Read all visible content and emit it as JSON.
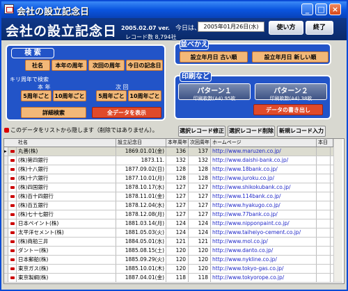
{
  "window": {
    "title": "会社の設立記念日"
  },
  "header": {
    "title": "会社の設立記念日",
    "version": "2005.02.07 ver.",
    "record_count": "レコード数 8,794社",
    "today_label": "今日は、",
    "today_value": "2005年01月26日(水)",
    "howto_label": "使い方",
    "exit_label": "終了"
  },
  "search": {
    "heading": "検 索",
    "buttons": [
      "社名",
      "本年の周年",
      "次回の周年",
      "今日の記念日"
    ],
    "kiri_label": "キリ周年で検索",
    "this_year_label": "本 年",
    "next_label": "次 回",
    "kiri_buttons": [
      "5周年ごと",
      "10周年ごと",
      "5周年ごと",
      "10周年ごと"
    ],
    "detail_label": "詳細検索",
    "showall_label": "全データを表示"
  },
  "sort": {
    "heading": "並べかえ",
    "asc_label": "設立年月日 古い順",
    "desc_label": "設立年月日 新しい順"
  },
  "print": {
    "heading": "印刷など",
    "p1_title": "パターン１",
    "p1_sub": "印刷枚数(A4)   95枚",
    "p2_title": "パターン２",
    "p2_sub": "印刷枚数(A4)   38枚",
    "export_label": "データの書き出し"
  },
  "notice": "このデータをリストから隠します（削除ではありません）。",
  "actions": {
    "modify": "選択レコード修正",
    "delete": "選択レコード削除",
    "new": "新規レコード入力"
  },
  "table": {
    "headers": [
      "社名",
      "設立記念日",
      "本年周年",
      "次回周年",
      "ホームページ",
      "本日"
    ],
    "rows": [
      {
        "name": "丸善(株)",
        "date": "1869.01.01(金)",
        "n1": "136",
        "n2": "137",
        "url": "http://www.maruzen.co.jp/"
      },
      {
        "name": "(株)第四銀行",
        "date": "1873.11.",
        "n1": "132",
        "n2": "132",
        "url": "http://www.daishi-bank.co.jp/"
      },
      {
        "name": "(株)十八銀行",
        "date": "1877.09.02(日)",
        "n1": "128",
        "n2": "128",
        "url": "http://www.18bank.co.jp/"
      },
      {
        "name": "(株)十六銀行",
        "date": "1877.10.01(月)",
        "n1": "128",
        "n2": "128",
        "url": "http://www.juroku.co.jp/"
      },
      {
        "name": "(株)四国銀行",
        "date": "1878.10.17(水)",
        "n1": "127",
        "n2": "127",
        "url": "http://www.shikokubank.co.jp/"
      },
      {
        "name": "(株)百十四銀行",
        "date": "1878.11.01(金)",
        "n1": "127",
        "n2": "127",
        "url": "http://www.114bank.co.jp/"
      },
      {
        "name": "(株)百五銀行",
        "date": "1878.12.04(水)",
        "n1": "127",
        "n2": "127",
        "url": "http://www.hyakugo.co.jp/"
      },
      {
        "name": "(株)七十七銀行",
        "date": "1878.12.08(月)",
        "n1": "127",
        "n2": "127",
        "url": "http://www.77bank.co.jp/"
      },
      {
        "name": "日本ペイント(株)",
        "date": "1881.03.14(月)",
        "n1": "124",
        "n2": "124",
        "url": "http://www.nipponpaint.co.jp/"
      },
      {
        "name": "太平洋セメント(株)",
        "date": "1881.05.03(火)",
        "n1": "124",
        "n2": "124",
        "url": "http://www.taiheiyo-cement.co.jp/"
      },
      {
        "name": "(株)商船三井",
        "date": "1884.05.01(水)",
        "n1": "121",
        "n2": "121",
        "url": "http://www.mol.co.jp/"
      },
      {
        "name": "ダントー(株)",
        "date": "1885.08.15(土)",
        "n1": "120",
        "n2": "120",
        "url": "http://www.danto.co.jp/"
      },
      {
        "name": "日本郵船(株)",
        "date": "1885.09.29(火)",
        "n1": "120",
        "n2": "120",
        "url": "http://www.nykline.co.jp/"
      },
      {
        "name": "東京ガス(株)",
        "date": "1885.10.01(木)",
        "n1": "120",
        "n2": "120",
        "url": "http://www.tokyo-gas.co.jp/"
      },
      {
        "name": "東京製綱(株)",
        "date": "1887.04.01(金)",
        "n1": "118",
        "n2": "118",
        "url": "http://www.tokyorope.co.jp/"
      }
    ]
  }
}
